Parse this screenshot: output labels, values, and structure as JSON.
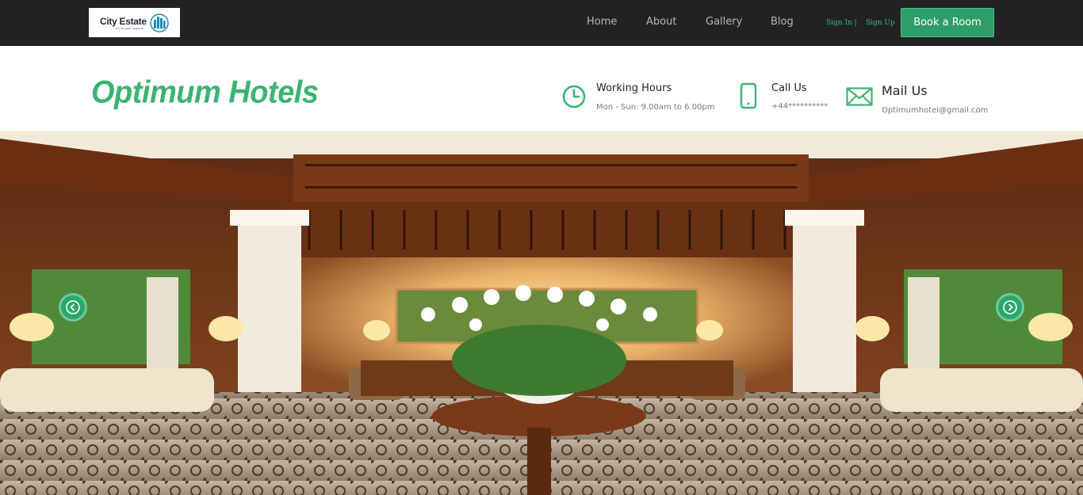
{
  "topbar": {
    "logo": {
      "name": "City Estate",
      "tagline": "It's for your hygiene"
    },
    "nav": [
      "Home",
      "About",
      "Gallery",
      "Blog"
    ],
    "sign_in": "Sign In |",
    "sign_up": "Sign Up",
    "book_button": "Book a Room"
  },
  "header": {
    "brand": "Optimum Hotels",
    "working_hours": {
      "title": "Working Hours",
      "value": "Mon - Sun: 9.00am to 6.00pm",
      "icon": "clock-icon"
    },
    "call": {
      "title": "Call Us",
      "value": "+44**********",
      "icon": "phone-icon"
    },
    "mail": {
      "title": "Mail Us",
      "value": "Optimumhotel@gmail.com",
      "icon": "envelope-icon"
    }
  },
  "hero": {
    "image": "hotel lobby",
    "prev_icon": "chevron-left-icon",
    "next_icon": "chevron-right-icon"
  },
  "colors": {
    "accent": "#3cb371",
    "button": "#2f9d68",
    "topbar": "#222222"
  }
}
